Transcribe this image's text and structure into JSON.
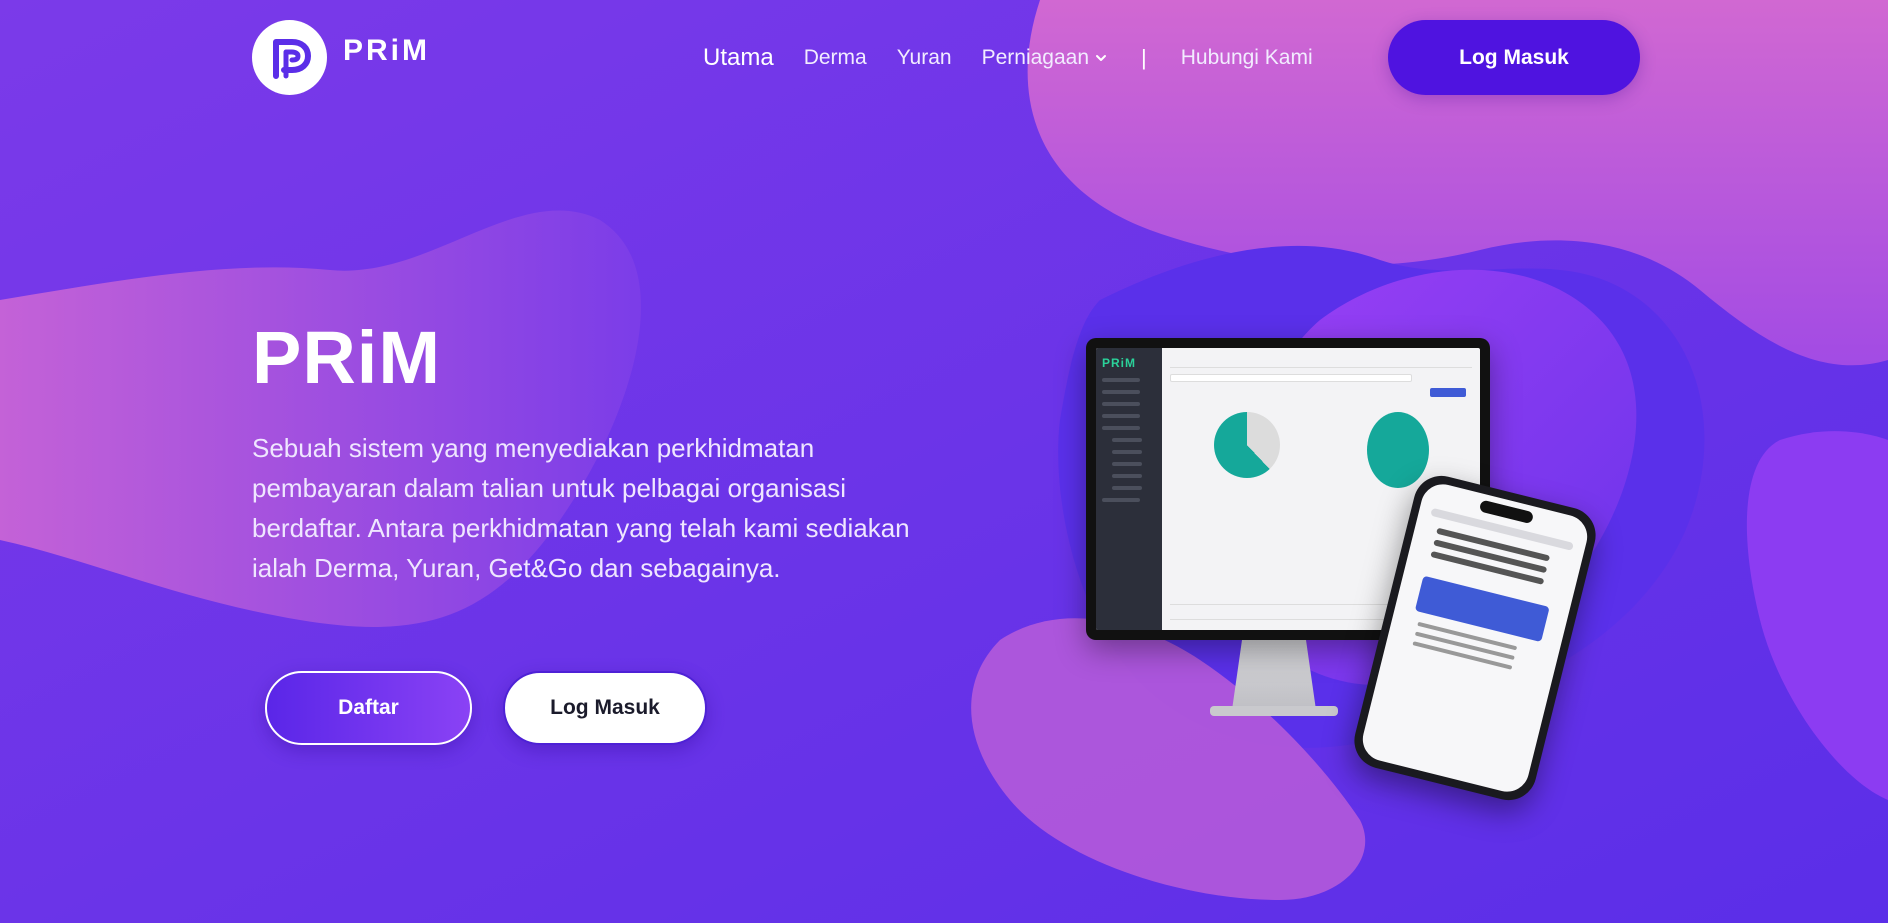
{
  "brand": {
    "name": "PRiM",
    "logo_letter": "P"
  },
  "nav": {
    "items": [
      {
        "label": "Utama",
        "active": true
      },
      {
        "label": "Derma"
      },
      {
        "label": "Yuran"
      },
      {
        "label": "Perniagaan",
        "has_dropdown": true
      }
    ],
    "separator": "|",
    "contact": "Hubungi Kami",
    "login": "Log Masuk"
  },
  "hero": {
    "title": "PRiM",
    "description": "Sebuah sistem yang menyediakan perkhidmatan pembayaran dalam talian untuk pelbagai organisasi berdaftar. Antara perkhidmatan yang telah kami sediakan ialah Derma, Yuran, Get&Go dan sebagainya.",
    "primary_button": "Daftar",
    "secondary_button": "Log Masuk"
  },
  "colors": {
    "background": "#5b2ee8",
    "blob_pink": "#d66ad6",
    "blob_violet": "#8a3cf0",
    "login_button": "#4f13e0"
  },
  "icons": {
    "logo": "prim-logo-icon",
    "dropdown": "chevron-down-icon"
  }
}
